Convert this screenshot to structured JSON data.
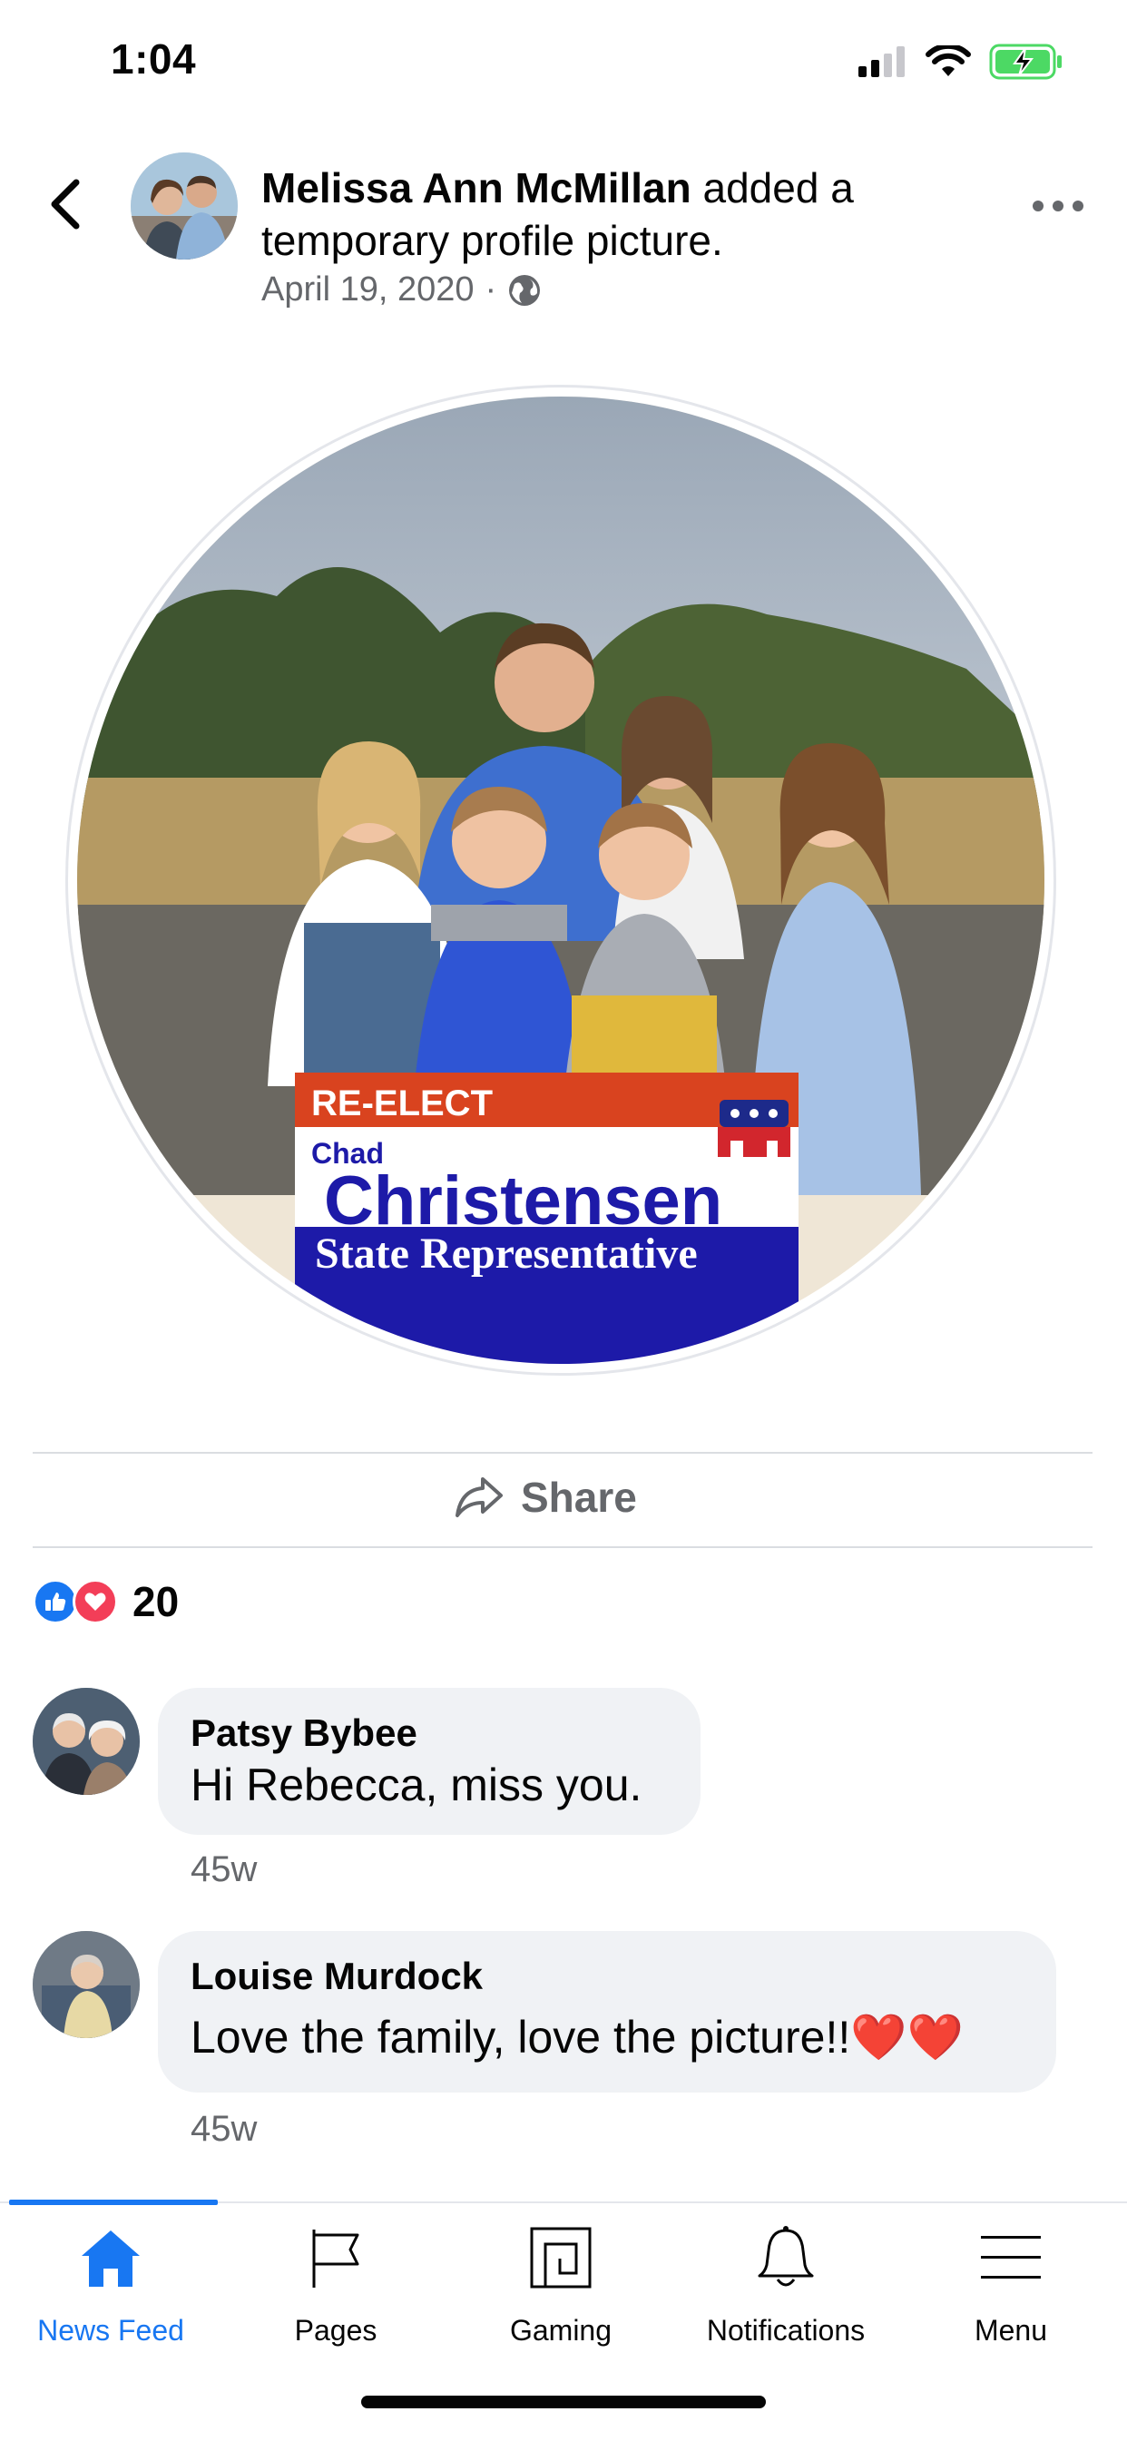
{
  "status_bar": {
    "time": "1:04",
    "icons": [
      "signal-icon",
      "wifi-icon",
      "battery-charging-icon"
    ]
  },
  "post": {
    "author": "Melissa Ann McMillan",
    "action": "added a temporary profile picture.",
    "date": "April 19, 2020",
    "separator": "·",
    "audience_icon": "globe-icon"
  },
  "picture": {
    "sign_line1": "RE-ELECT",
    "sign_line2": "Chad",
    "sign_line3": "Christensen",
    "sign_line4": "State Representative"
  },
  "actions": {
    "share_label": "Share"
  },
  "reactions": {
    "icons": [
      "like-icon",
      "love-icon"
    ],
    "count": "20"
  },
  "comments": [
    {
      "name": "Patsy Bybee",
      "text": "Hi Rebecca, miss you.",
      "time": "45w"
    },
    {
      "name": "Louise Murdock",
      "text": "Love the family, love the picture!!",
      "emoji": "❤️❤️",
      "time": "45w"
    }
  ],
  "tab_bar": {
    "tabs": [
      {
        "label": "News Feed",
        "icon": "home-icon",
        "active": true
      },
      {
        "label": "Pages",
        "icon": "flag-icon",
        "active": false
      },
      {
        "label": "Gaming",
        "icon": "gaming-icon",
        "active": false
      },
      {
        "label": "Notifications",
        "icon": "bell-icon",
        "active": false
      },
      {
        "label": "Menu",
        "icon": "hamburger-icon",
        "active": false
      }
    ]
  },
  "colors": {
    "accent": "#1877f2",
    "secondary_text": "#65676b",
    "bubble": "#f0f2f5",
    "love": "#f33e58",
    "battery": "#4cd964"
  }
}
